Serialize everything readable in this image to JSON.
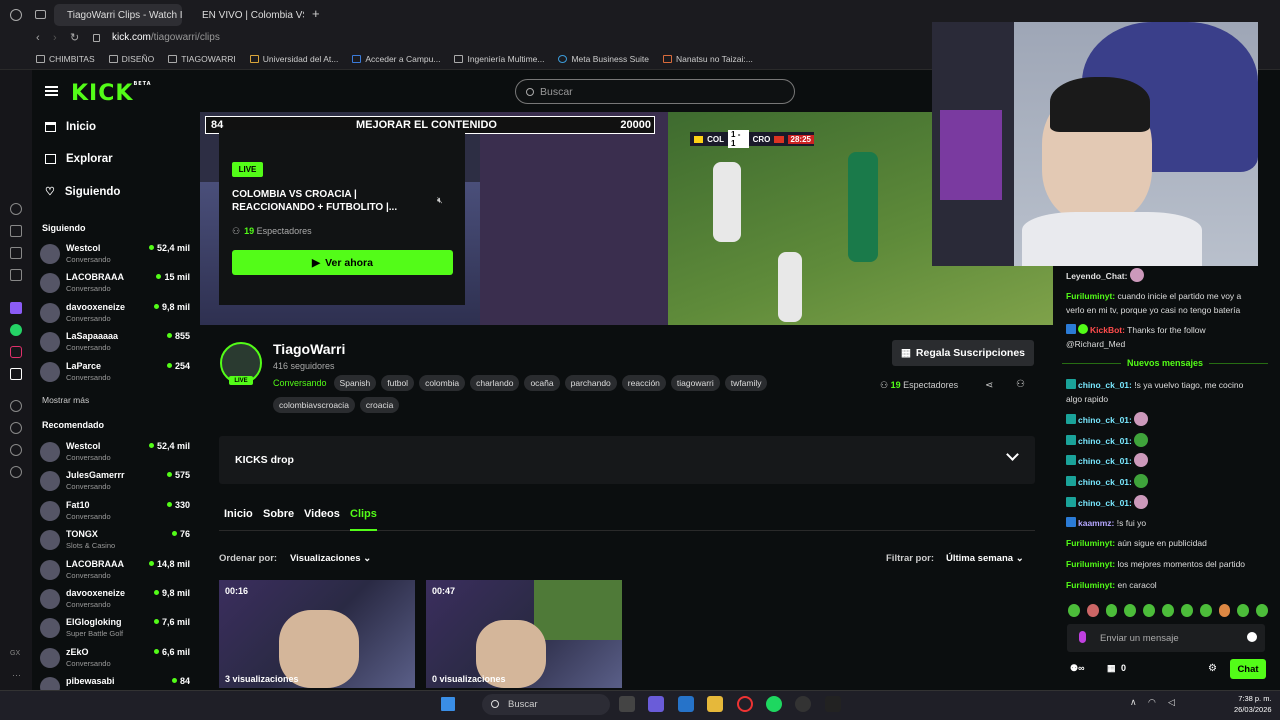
{
  "browser": {
    "tabs": [
      {
        "label": "TiagoWarri Clips - Watch I",
        "active": true
      },
      {
        "label": "EN VIVO | Colombia VS",
        "active": false
      }
    ],
    "url_domain": "kick.com",
    "url_path": "/tiagowarri/clips",
    "bookmarks": [
      "CHIMBITAS",
      "DISEÑO",
      "TIAGOWARRI",
      "Universidad del At...",
      "Acceder a Campu...",
      "Ingeniería Multime...",
      "Meta Business Suite",
      "Nanatsu no Taizai:..."
    ]
  },
  "header": {
    "logo": "KICK",
    "logo_beta": "BETA",
    "search_placeholder": "Buscar"
  },
  "nav": {
    "main": [
      {
        "label": "Inicio",
        "icon": "home-icon"
      },
      {
        "label": "Explorar",
        "icon": "browse-icon"
      },
      {
        "label": "Siguiendo",
        "icon": "heart-icon"
      }
    ],
    "following_title": "Siguiendo",
    "following": [
      {
        "name": "Westcol",
        "category": "Conversando",
        "viewers": "52,4 mil"
      },
      {
        "name": "LACOBRAAA",
        "category": "Conversando",
        "viewers": "15 mil"
      },
      {
        "name": "davooxeneize",
        "category": "Conversando",
        "viewers": "9,8 mil"
      },
      {
        "name": "LaSapaaaaa",
        "category": "Conversando",
        "viewers": "855"
      },
      {
        "name": "LaParce",
        "category": "Conversando",
        "viewers": "254"
      }
    ],
    "show_more": "Mostrar más",
    "recommended_title": "Recomendado",
    "recommended": [
      {
        "name": "Westcol",
        "category": "Conversando",
        "viewers": "52,4 mil"
      },
      {
        "name": "JulesGamerrr",
        "category": "Conversando",
        "viewers": "575"
      },
      {
        "name": "Fat10",
        "category": "Conversando",
        "viewers": "330"
      },
      {
        "name": "TONGX",
        "category": "Slots & Casino",
        "viewers": "76"
      },
      {
        "name": "LACOBRAAA",
        "category": "Conversando",
        "viewers": "14,8 mil"
      },
      {
        "name": "davooxeneize",
        "category": "Conversando",
        "viewers": "9,8 mil"
      },
      {
        "name": "ElGlogloking",
        "category": "Super Battle Golf",
        "viewers": "7,6 mil"
      },
      {
        "name": "zEkO",
        "category": "Conversando",
        "viewers": "6,6 mil"
      },
      {
        "name": "pibewasabi",
        "category": "",
        "viewers": "84"
      }
    ]
  },
  "banner": {
    "left_number": "84",
    "center_text": "MEJORAR EL CONTENIDO",
    "right_number": "20000",
    "score": {
      "team1": "COL",
      "result": "1 - 1",
      "team2": "CRO",
      "time": "28:25"
    }
  },
  "live_card": {
    "badge": "LIVE",
    "title": "COLOMBIA VS CROACIA | REACCIONANDO + FUTBOLITO |...",
    "viewers_count": "19",
    "viewers_label": "Espectadores",
    "watch_button": "Ver ahora"
  },
  "channel": {
    "name": "TiagoWarri",
    "live_badge": "LIVE",
    "followers": "416 seguidores",
    "category": "Conversando",
    "tags": [
      "Spanish",
      "futbol",
      "colombia",
      "charlando",
      "ocaña",
      "parchando",
      "reacción",
      "tiagowarri",
      "twfamily",
      "colombiavscroacia",
      "croacia"
    ],
    "subs_button": "Regala Suscripciones",
    "spectators_count": "19",
    "spectators_label": "Espectadores"
  },
  "kicks_drop": "KICKS drop",
  "content_tabs": [
    "Inicio",
    "Sobre",
    "Videos",
    "Clips"
  ],
  "active_tab": "Clips",
  "sort": {
    "label": "Ordenar por:",
    "value": "Visualizaciones"
  },
  "filter": {
    "label": "Filtrar por:",
    "value": "Última semana"
  },
  "clips": [
    {
      "duration": "00:16",
      "views": "3 visualizaciones"
    },
    {
      "duration": "00:47",
      "views": "0 visualizaciones"
    }
  ],
  "chat": {
    "messages": [
      {
        "user": "Leyendo_Chat:",
        "text": "",
        "color": "w"
      },
      {
        "user": "Furiluminyt:",
        "text": " cuando inicie el partido me voy a verlo en mi tv, porque yo casi no tengo batería",
        "color": "g"
      },
      {
        "user": "KickBot:",
        "text": " Thanks for the follow @Richard_Med",
        "color": "r"
      }
    ],
    "new_messages_label": "Nuevos mensajes",
    "new_messages": [
      {
        "user": "chino_ck_01:",
        "text": " !s ya vuelvo tiago, me cocino algo rapido",
        "color": "c"
      },
      {
        "user": "chino_ck_01:",
        "text": "",
        "color": "c"
      },
      {
        "user": "chino_ck_01:",
        "text": "",
        "color": "c"
      },
      {
        "user": "chino_ck_01:",
        "text": "",
        "color": "c"
      },
      {
        "user": "chino_ck_01:",
        "text": "",
        "color": "c"
      },
      {
        "user": "chino_ck_01:",
        "text": "",
        "color": "c"
      },
      {
        "user": "kaammz:",
        "text": " !s fui yo",
        "color": "v"
      },
      {
        "user": "Furiluminyt:",
        "text": " aún sigue en publicidad",
        "color": "g"
      },
      {
        "user": "Furiluminyt:",
        "text": " los mejores momentos del partido",
        "color": "g"
      },
      {
        "user": "Furiluminyt:",
        "text": " en caracol",
        "color": "g"
      }
    ],
    "input_placeholder": "Enviar un mensaje",
    "kicks_count": "0",
    "send_button": "Chat"
  },
  "taskbar": {
    "search_placeholder": "Buscar",
    "time": "7:38 p. m.",
    "date": "26/03/2026"
  }
}
